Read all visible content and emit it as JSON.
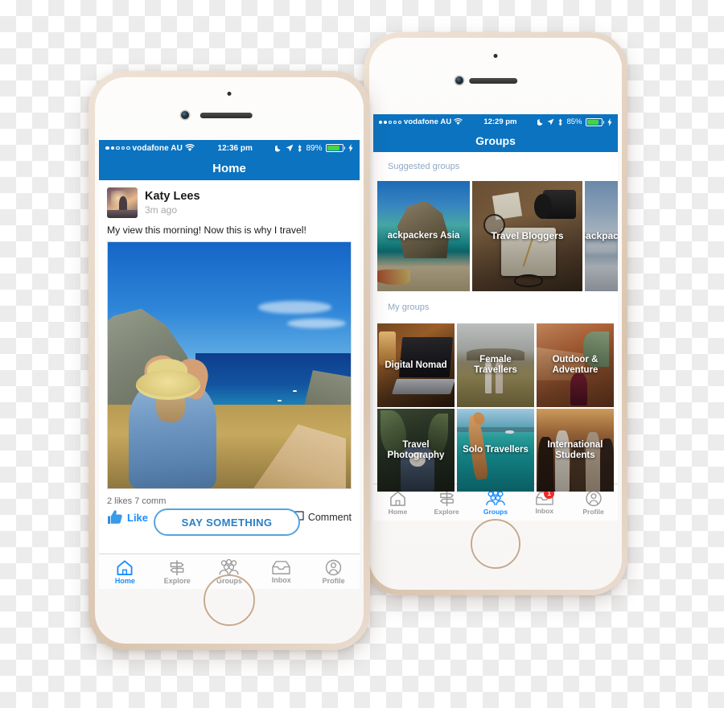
{
  "meta": {
    "accent_blue": "#0b73c0",
    "tab_active_blue": "#1a8cff",
    "badge_red": "#ef2b2b",
    "section_title_color": "#8fa8c4"
  },
  "phone_left": {
    "status": {
      "carrier": "vodafone AU",
      "time": "12:36 pm",
      "battery_percent": "89%",
      "icons": [
        "signal-dots",
        "wifi-icon",
        "moon-icon",
        "location-arrow-icon",
        "bluetooth-icon",
        "battery-icon",
        "charging-bolt-icon"
      ]
    },
    "navbar": {
      "title": "Home"
    },
    "post": {
      "author": "Katy Lees",
      "time": "3m ago",
      "caption": "My view this morning! Now this is why I travel!",
      "meta": "2 likes 7 comm",
      "like_label": "Like",
      "comment_label": "Comment",
      "say_something": "SAY SOMETHING"
    },
    "tabs": [
      {
        "label": "Home",
        "icon": "home-icon",
        "active": true,
        "badge": ""
      },
      {
        "label": "Explore",
        "icon": "signpost-icon",
        "active": false,
        "badge": ""
      },
      {
        "label": "Groups",
        "icon": "people-icon",
        "active": false,
        "badge": ""
      },
      {
        "label": "Inbox",
        "icon": "inbox-icon",
        "active": false,
        "badge": ""
      },
      {
        "label": "Profile",
        "icon": "person-circle-icon",
        "active": false,
        "badge": ""
      }
    ]
  },
  "phone_right": {
    "status": {
      "carrier": "vodafone AU",
      "time": "12:29 pm",
      "battery_percent": "85%",
      "icons": [
        "signal-dots",
        "wifi-icon",
        "moon-icon",
        "location-arrow-icon",
        "bluetooth-icon",
        "battery-icon",
        "charging-bolt-icon"
      ]
    },
    "navbar": {
      "title": "Groups"
    },
    "sections": [
      {
        "title": "Suggested groups",
        "tiles": [
          {
            "label": "ackpackers Asia",
            "art": "beach-karst"
          },
          {
            "label": "Travel Bloggers",
            "art": "desk-camera-map"
          },
          {
            "label": "Backpack",
            "art": "ocean-shore"
          }
        ]
      },
      {
        "title": "My groups",
        "tiles": [
          {
            "label": "Digital Nomad",
            "art": "laptop-desk"
          },
          {
            "label": "Female\nTravellers",
            "art": "field-two-girls"
          },
          {
            "label": "Outdoor &\nAdventure",
            "art": "canyon-red"
          },
          {
            "label": "Travel\nPhotography",
            "art": "forest-photographer"
          },
          {
            "label": "Solo Travellers",
            "art": "turquoise-jump"
          },
          {
            "label": "International\nStudents",
            "art": "crowd-sunset"
          }
        ]
      }
    ],
    "tabs": [
      {
        "label": "Home",
        "icon": "home-icon",
        "active": false,
        "badge": ""
      },
      {
        "label": "Explore",
        "icon": "signpost-icon",
        "active": false,
        "badge": ""
      },
      {
        "label": "Groups",
        "icon": "people-icon",
        "active": true,
        "badge": ""
      },
      {
        "label": "Inbox",
        "icon": "inbox-icon",
        "active": false,
        "badge": "1"
      },
      {
        "label": "Profile",
        "icon": "person-circle-icon",
        "active": false,
        "badge": ""
      }
    ]
  }
}
